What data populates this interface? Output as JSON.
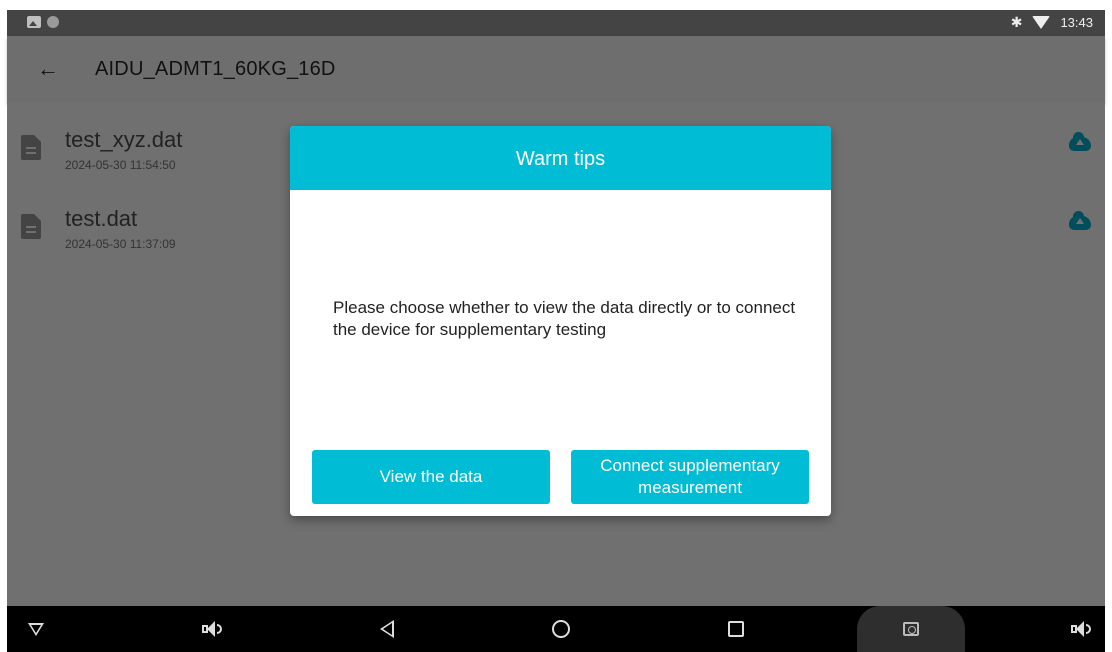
{
  "status_bar": {
    "time": "13:43",
    "icons": [
      "image-notification-icon",
      "circle-notification-icon",
      "bluetooth-icon",
      "wifi-icon"
    ]
  },
  "app_bar": {
    "title": "AIDU_ADMT1_60KG_16D",
    "back_icon": "arrow-left-icon"
  },
  "files": [
    {
      "name": "test_xyz.dat",
      "date": "2024-05-30 11:54:50",
      "icon": "file-icon",
      "action_icon": "cloud-upload-icon"
    },
    {
      "name": "test.dat",
      "date": "2024-05-30 11:37:09",
      "icon": "file-icon",
      "action_icon": "cloud-upload-icon"
    }
  ],
  "dialog": {
    "title": "Warm tips",
    "message": "Please choose whether to view the data directly or to connect the device for supplementary testing",
    "buttons": {
      "view": "View the data",
      "connect": "Connect supplementary measurement"
    }
  },
  "nav_bar": {
    "icons": [
      "hide-nav-icon",
      "volume-down-icon",
      "back-icon",
      "home-icon",
      "recents-icon",
      "screenshot-icon",
      "volume-up-icon"
    ]
  },
  "colors": {
    "accent": "#00bcd4",
    "scrim": "#707070",
    "upload_icon": "#004d5c"
  }
}
